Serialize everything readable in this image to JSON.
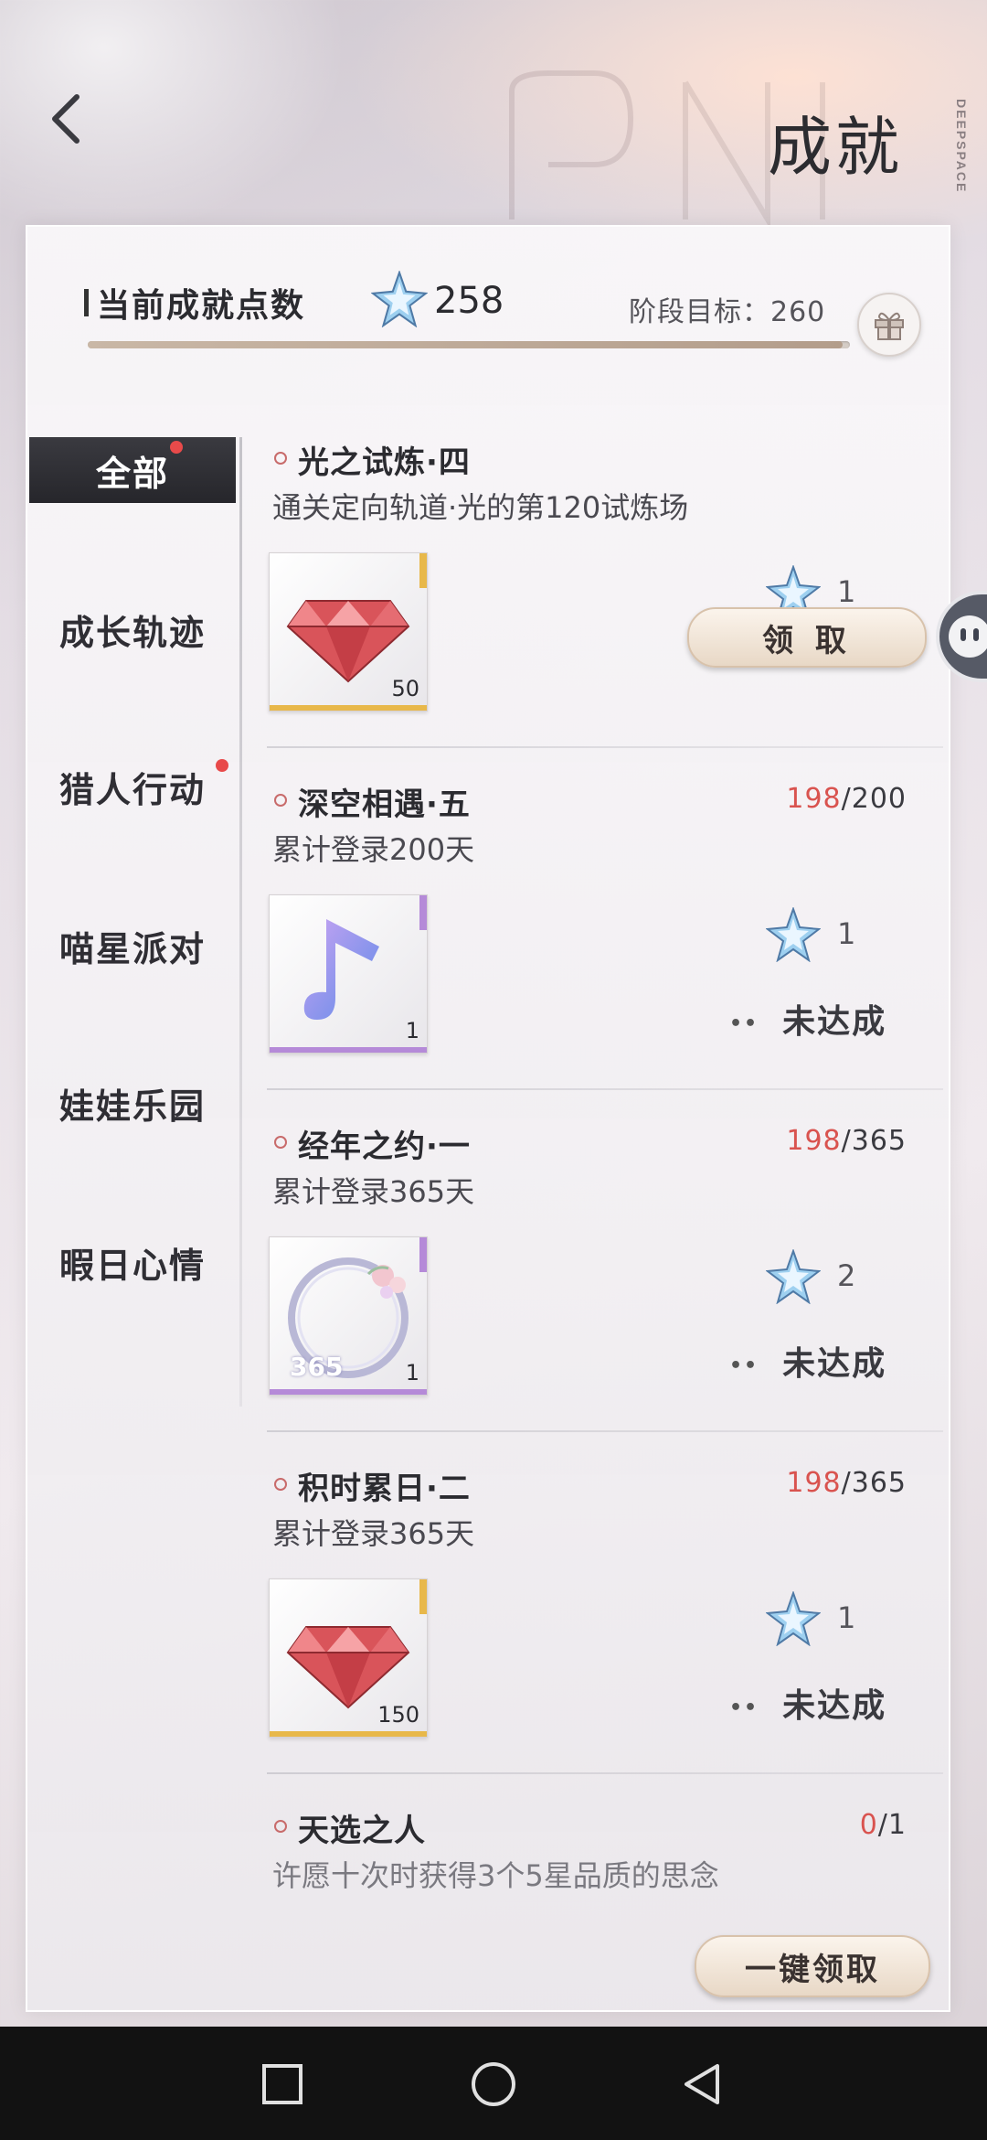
{
  "header": {
    "title": "成就",
    "watermark_vertical": "DEEPSPACE"
  },
  "summary": {
    "points_label": "当前成就点数",
    "points_value": "258",
    "stage_goal": "阶段目标：260",
    "progress_fraction": 0.99
  },
  "sidebar": {
    "items": [
      {
        "label": "全部",
        "active": true,
        "badge": true
      },
      {
        "label": "成长轨迹",
        "active": false,
        "badge": false
      },
      {
        "label": "猎人行动",
        "active": false,
        "badge": true
      },
      {
        "label": "喵星派对",
        "active": false,
        "badge": false
      },
      {
        "label": "娃娃乐园",
        "active": false,
        "badge": false
      },
      {
        "label": "暇日心情",
        "active": false,
        "badge": false
      }
    ]
  },
  "achievements": [
    {
      "title": "光之试炼·四",
      "desc": "通关定向轨道·光的第120试炼场",
      "progress_current": "",
      "progress_total": "",
      "item": "red-diamond",
      "item_qty": "50",
      "reward_points": "1",
      "status": "领 取"
    },
    {
      "title": "深空相遇·五",
      "desc": "累计登录200天",
      "progress_current": "198",
      "progress_total": "/200",
      "item": "music-note",
      "item_qty": "1",
      "reward_points": "1",
      "status": "未达成"
    },
    {
      "title": "经年之约·一",
      "desc": "累计登录365天",
      "progress_current": "198",
      "progress_total": "/365",
      "item": "floral-frame",
      "item_qty": "1",
      "item_overlay": "365",
      "reward_points": "2",
      "status": "未达成"
    },
    {
      "title": "积时累日·二",
      "desc": "累计登录365天",
      "progress_current": "198",
      "progress_total": "/365",
      "item": "red-diamond",
      "item_qty": "150",
      "reward_points": "1",
      "status": "未达成"
    },
    {
      "title": "天选之人",
      "desc": "许愿十次时获得3个5星品质的思念",
      "progress_current": "0",
      "progress_total": "/1"
    }
  ],
  "footer": {
    "claim_all": "一键领取"
  },
  "colors": {
    "accent_red": "#d9534f",
    "gold_quality": "#e8b84a",
    "purple_quality": "#b58ad8",
    "dark_tab": "#2b2b30"
  }
}
